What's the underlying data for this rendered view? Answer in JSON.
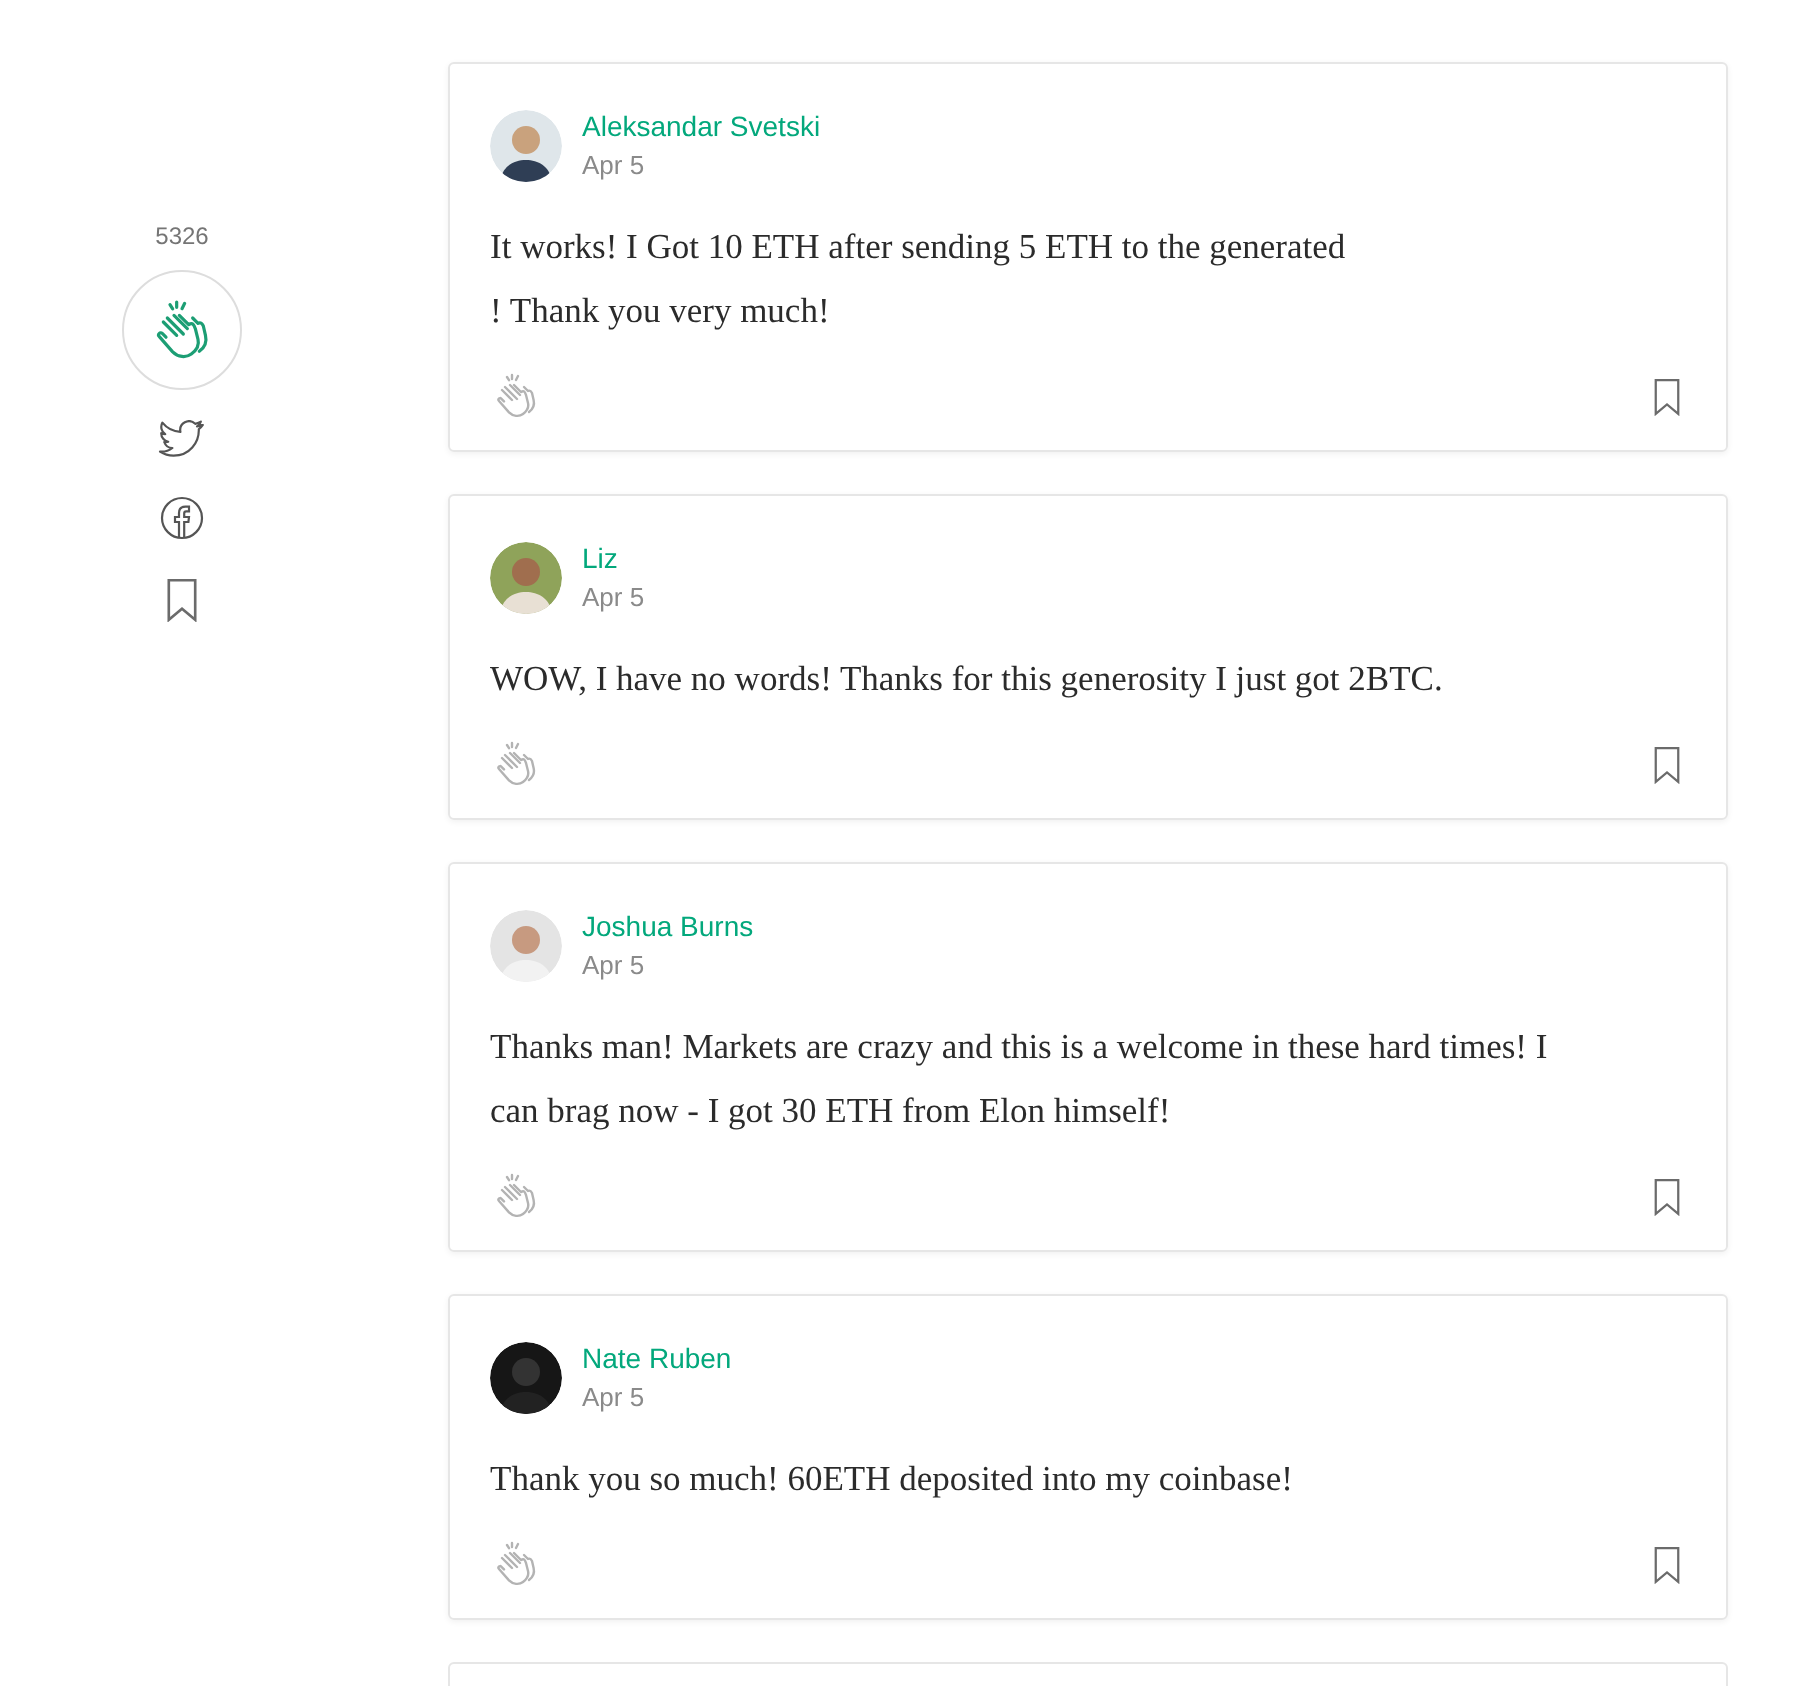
{
  "sidebar": {
    "clap_count": "5326"
  },
  "responses": [
    {
      "author": "Aleksandar Svetski",
      "date": "Apr 5",
      "lines": [
        "It works! I Got 10 ETH after sending 5 ETH to the generated",
        "! Thank you very much!"
      ],
      "avatar": {
        "kind": "picture"
      }
    },
    {
      "author": "Liz",
      "date": "Apr 5",
      "lines": [
        "WOW, I have no words! Thanks for this generosity I just got 2BTC."
      ],
      "avatar": {
        "kind": "picture"
      }
    },
    {
      "author": "Joshua Burns",
      "date": "Apr 5",
      "lines": [
        "Thanks man! Markets are crazy and this is a welcome in these hard times! I",
        "can brag now - I got 30 ETH from Elon himself!"
      ],
      "avatar": {
        "kind": "picture"
      }
    },
    {
      "author": "Nate Ruben",
      "date": "Apr 5",
      "lines": [
        "Thank you so much! 60ETH deposited into my coinbase!"
      ],
      "avatar": {
        "kind": "picture"
      }
    }
  ]
}
